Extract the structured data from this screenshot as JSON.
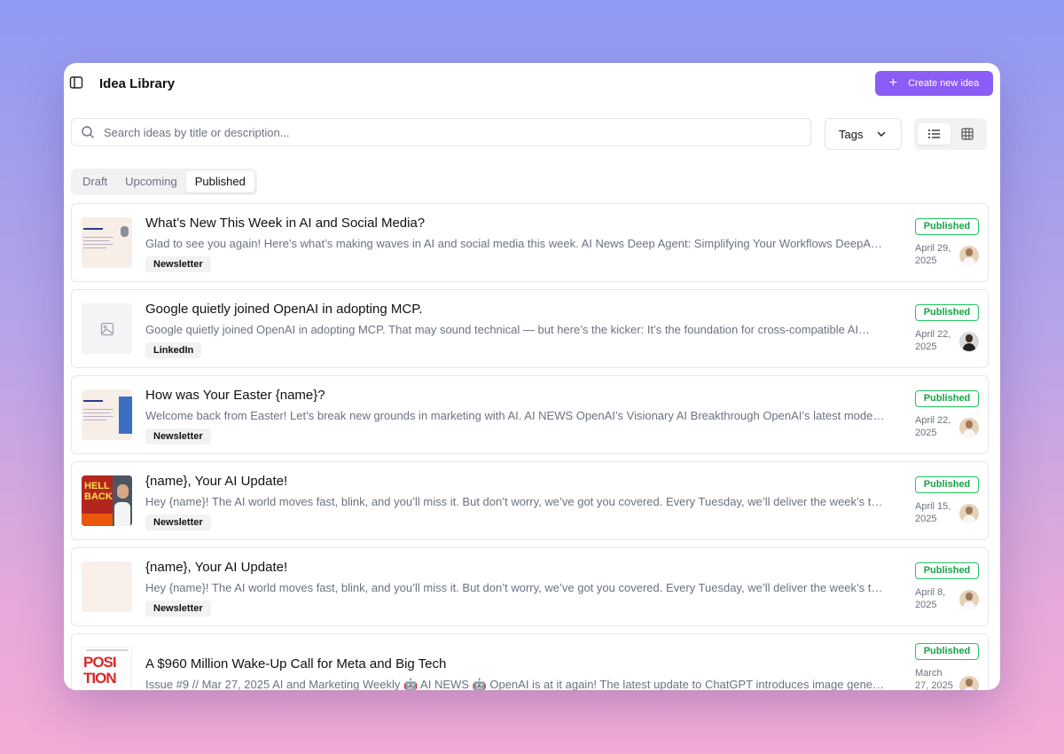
{
  "header": {
    "title": "Idea Library",
    "create_button": "Create new idea"
  },
  "search": {
    "placeholder": "Search ideas by title or description..."
  },
  "filters": {
    "tags_label": "Tags"
  },
  "tabs": [
    {
      "label": "Draft",
      "active": false
    },
    {
      "label": "Upcoming",
      "active": false
    },
    {
      "label": "Published",
      "active": true
    }
  ],
  "colors": {
    "accent": "#8b5cf6",
    "status_green": "#16a34a"
  },
  "ideas": [
    {
      "title": "What’s New This Week in AI and Social Media?",
      "description": "Glad to see you again! Here’s what’s making waves in AI and social media this week. AI News Deep Agent: Simplifying Your Workflows DeepAge…",
      "tag": "Newsletter",
      "status": "Published",
      "date": "April 29, 2025"
    },
    {
      "title": "Google quietly joined OpenAI in adopting MCP.",
      "description": "Google quietly joined OpenAI in adopting MCP. That may sound technical — but here’s the kicker: It’s the foundation for cross-compatible AI…",
      "tag": "LinkedIn",
      "status": "Published",
      "date": "April 22, 2025"
    },
    {
      "title": "How was Your Easter {name}?",
      "description": "Welcome back from Easter! Let’s break new grounds in marketing with AI. AI NEWS OpenAI’s Visionary AI Breakthrough OpenAI’s latest models,…",
      "tag": "Newsletter",
      "status": "Published",
      "date": "April 22, 2025"
    },
    {
      "title": "{name}, Your AI Update!",
      "description": "Hey {name}! The AI world moves fast, blink, and you’ll miss it. But don’t worry, we’ve got you covered. Every Tuesday, we’ll deliver the week’s to…",
      "tag": "Newsletter",
      "status": "Published",
      "date": "April 15, 2025"
    },
    {
      "title": "{name}, Your AI Update!",
      "description": "Hey {name}! The AI world moves fast, blink, and you’ll miss it. But don’t worry, we’ve got you covered. Every Tuesday, we’ll deliver the week’s to…",
      "tag": "Newsletter",
      "status": "Published",
      "date": "April 8, 2025"
    },
    {
      "title": "A $960 Million Wake-Up Call for Meta and Big Tech",
      "description": "Issue #9 // Mar 27, 2025 AI and Marketing Weekly 🤖 AI NEWS 🤖 OpenAI is at it again! The latest update to ChatGPT introduces image generatio…",
      "tag": "",
      "status": "Published",
      "date": "March 27, 2025"
    }
  ],
  "thumbnails": {
    "poster_a_text": "HELL BACK",
    "poster_b_text": "POSI TION"
  }
}
